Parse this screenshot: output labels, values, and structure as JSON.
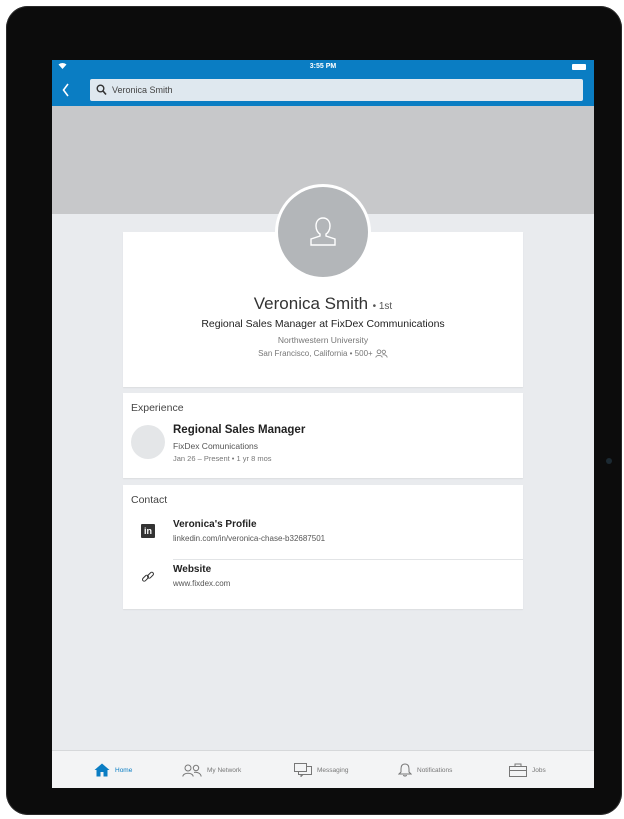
{
  "status_bar": {
    "time": "3:55 PM"
  },
  "search": {
    "value": "Veronica Smith"
  },
  "profile": {
    "name": "Veronica Smith",
    "degree": "• 1st",
    "headline": "Regional Sales Manager at FixDex Communications",
    "school": "Northwestern University",
    "location": "San Francisco, California • 500+"
  },
  "experience": {
    "title": "Experience",
    "items": [
      {
        "role": "Regional Sales Manager",
        "company": "FixDex Comunications",
        "dates": "Jan 26 – Present • 1 yr 8 mos"
      }
    ]
  },
  "contact": {
    "title": "Contact",
    "items": [
      {
        "label": "Veronica's Profile",
        "value": "linkedin.com/in/veronica-chase-b32687501",
        "icon": "linkedin-icon"
      },
      {
        "label": "Website",
        "value": "www.fixdex.com",
        "icon": "link-icon"
      }
    ]
  },
  "tabs": [
    {
      "label": "Home",
      "icon": "home-icon",
      "active": true
    },
    {
      "label": "My Network",
      "icon": "network-icon",
      "active": false
    },
    {
      "label": "Messaging",
      "icon": "messaging-icon",
      "active": false
    },
    {
      "label": "Notifications",
      "icon": "bell-icon",
      "active": false
    },
    {
      "label": "Jobs",
      "icon": "briefcase-icon",
      "active": false
    }
  ],
  "colors": {
    "brand": "#0a7dc3",
    "cover": "#c7c8ca",
    "background": "#e9ebee"
  }
}
